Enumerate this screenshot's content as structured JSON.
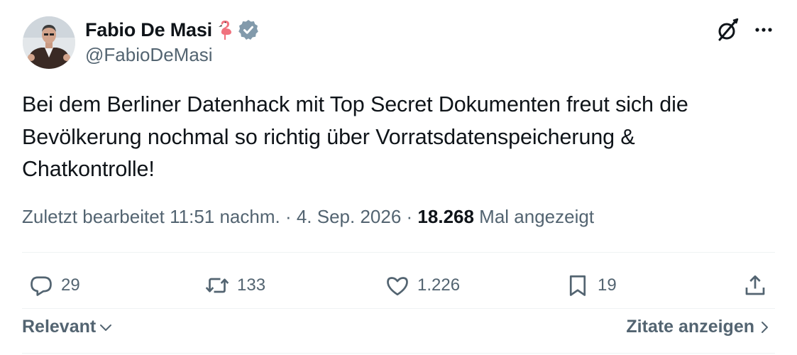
{
  "author": {
    "name": "Fabio De Masi",
    "handle": "@FabioDeMasi"
  },
  "tweet": {
    "text": "Bei dem Berliner Datenhack mit Top Secret Dokumenten freut sich die\nBevölkerung nochmal so richtig über Vorratsdatenspeicherung &\nChatkontrolle!"
  },
  "meta": {
    "edited_time": "Zuletzt bearbeitet 11:51 nachm.",
    "separator1": " · ",
    "date": "4. Sep. 2026",
    "separator2": " · ",
    "view_count": "18.268",
    "view_label": " Mal angezeigt"
  },
  "actions": {
    "replies": "29",
    "retweets": "133",
    "likes": "1.226",
    "bookmarks": "19"
  },
  "footer": {
    "sort_label": "Relevant",
    "quotes_label": "Zitate anzeigen"
  },
  "colors": {
    "text": "#0f1419",
    "secondary": "#536471",
    "verified": "#829aab",
    "divider": "#eff3f4"
  }
}
